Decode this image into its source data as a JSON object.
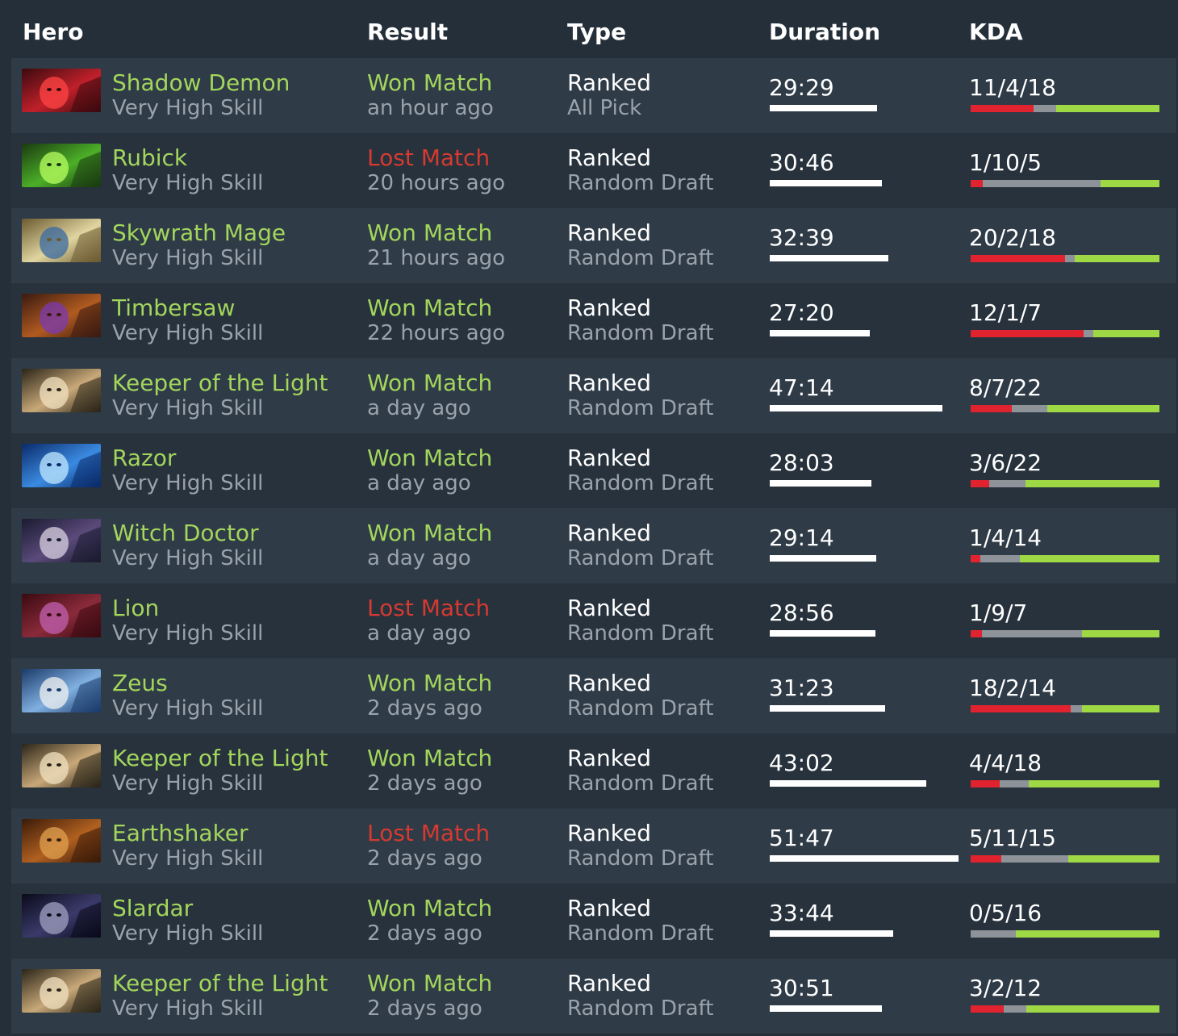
{
  "colors": {
    "background": "#242f39",
    "row_light": "#2f3b47",
    "row_dark": "#27323d",
    "won": "#a3d65c",
    "lost": "#d63a30",
    "kills_bar": "#e0232e",
    "deaths_bar": "#8d9399",
    "assists_bar": "#9fd845"
  },
  "header": {
    "hero": "Hero",
    "result": "Result",
    "type": "Type",
    "duration": "Duration",
    "kda": "KDA"
  },
  "matches": [
    {
      "hero": "Shadow Demon",
      "skill": "Very High Skill",
      "result": "Won Match",
      "outcome": "won",
      "when": "an hour ago",
      "type": "Ranked",
      "mode": "All Pick",
      "duration": "29:29",
      "duration_fraction": 0.57,
      "kda": "11/4/18",
      "k": 11,
      "d": 4,
      "a": 18,
      "portrait_icon": "shadow-demon-portrait"
    },
    {
      "hero": "Rubick",
      "skill": "Very High Skill",
      "result": "Lost Match",
      "outcome": "lost",
      "when": "20 hours ago",
      "type": "Ranked",
      "mode": "Random Draft",
      "duration": "30:46",
      "duration_fraction": 0.595,
      "kda": "1/10/5",
      "k": 1,
      "d": 10,
      "a": 5,
      "portrait_icon": "rubick-portrait"
    },
    {
      "hero": "Skywrath Mage",
      "skill": "Very High Skill",
      "result": "Won Match",
      "outcome": "won",
      "when": "21 hours ago",
      "type": "Ranked",
      "mode": "Random Draft",
      "duration": "32:39",
      "duration_fraction": 0.63,
      "kda": "20/2/18",
      "k": 20,
      "d": 2,
      "a": 18,
      "portrait_icon": "skywrath-mage-portrait"
    },
    {
      "hero": "Timbersaw",
      "skill": "Very High Skill",
      "result": "Won Match",
      "outcome": "won",
      "when": "22 hours ago",
      "type": "Ranked",
      "mode": "Random Draft",
      "duration": "27:20",
      "duration_fraction": 0.53,
      "kda": "12/1/7",
      "k": 12,
      "d": 1,
      "a": 7,
      "portrait_icon": "timbersaw-portrait"
    },
    {
      "hero": "Keeper of the Light",
      "skill": "Very High Skill",
      "result": "Won Match",
      "outcome": "won",
      "when": "a day ago",
      "type": "Ranked",
      "mode": "Random Draft",
      "duration": "47:14",
      "duration_fraction": 0.915,
      "kda": "8/7/22",
      "k": 8,
      "d": 7,
      "a": 22,
      "portrait_icon": "keeper-of-the-light-portrait"
    },
    {
      "hero": "Razor",
      "skill": "Very High Skill",
      "result": "Won Match",
      "outcome": "won",
      "when": "a day ago",
      "type": "Ranked",
      "mode": "Random Draft",
      "duration": "28:03",
      "duration_fraction": 0.54,
      "kda": "3/6/22",
      "k": 3,
      "d": 6,
      "a": 22,
      "portrait_icon": "razor-portrait"
    },
    {
      "hero": "Witch Doctor",
      "skill": "Very High Skill",
      "result": "Won Match",
      "outcome": "won",
      "when": "a day ago",
      "type": "Ranked",
      "mode": "Random Draft",
      "duration": "29:14",
      "duration_fraction": 0.565,
      "kda": "1/4/14",
      "k": 1,
      "d": 4,
      "a": 14,
      "portrait_icon": "witch-doctor-portrait"
    },
    {
      "hero": "Lion",
      "skill": "Very High Skill",
      "result": "Lost Match",
      "outcome": "lost",
      "when": "a day ago",
      "type": "Ranked",
      "mode": "Random Draft",
      "duration": "28:56",
      "duration_fraction": 0.56,
      "kda": "1/9/7",
      "k": 1,
      "d": 9,
      "a": 7,
      "portrait_icon": "lion-portrait"
    },
    {
      "hero": "Zeus",
      "skill": "Very High Skill",
      "result": "Won Match",
      "outcome": "won",
      "when": "2 days ago",
      "type": "Ranked",
      "mode": "Random Draft",
      "duration": "31:23",
      "duration_fraction": 0.61,
      "kda": "18/2/14",
      "k": 18,
      "d": 2,
      "a": 14,
      "portrait_icon": "zeus-portrait"
    },
    {
      "hero": "Keeper of the Light",
      "skill": "Very High Skill",
      "result": "Won Match",
      "outcome": "won",
      "when": "2 days ago",
      "type": "Ranked",
      "mode": "Random Draft",
      "duration": "43:02",
      "duration_fraction": 0.83,
      "kda": "4/4/18",
      "k": 4,
      "d": 4,
      "a": 18,
      "portrait_icon": "keeper-of-the-light-portrait"
    },
    {
      "hero": "Earthshaker",
      "skill": "Very High Skill",
      "result": "Lost Match",
      "outcome": "lost",
      "when": "2 days ago",
      "type": "Ranked",
      "mode": "Random Draft",
      "duration": "51:47",
      "duration_fraction": 1.0,
      "kda": "5/11/15",
      "k": 5,
      "d": 11,
      "a": 15,
      "portrait_icon": "earthshaker-portrait"
    },
    {
      "hero": "Slardar",
      "skill": "Very High Skill",
      "result": "Won Match",
      "outcome": "won",
      "when": "2 days ago",
      "type": "Ranked",
      "mode": "Random Draft",
      "duration": "33:44",
      "duration_fraction": 0.655,
      "kda": "0/5/16",
      "k": 0,
      "d": 5,
      "a": 16,
      "portrait_icon": "slardar-portrait"
    },
    {
      "hero": "Keeper of the Light",
      "skill": "Very High Skill",
      "result": "Won Match",
      "outcome": "won",
      "when": "2 days ago",
      "type": "Ranked",
      "mode": "Random Draft",
      "duration": "30:51",
      "duration_fraction": 0.595,
      "kda": "3/2/12",
      "k": 3,
      "d": 2,
      "a": 12,
      "portrait_icon": "keeper-of-the-light-portrait"
    }
  ]
}
